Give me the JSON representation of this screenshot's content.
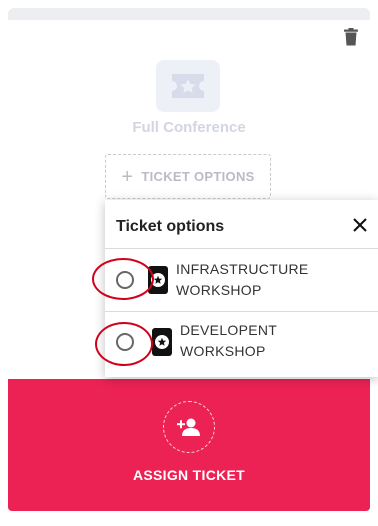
{
  "ticket": {
    "name": "Full Conference",
    "options_button_label": "TICKET OPTIONS",
    "options_button_icon": "plus-icon",
    "delete_icon": "trash-icon",
    "ticket_icon": "ticket-star-icon"
  },
  "popover": {
    "title": "Ticket options",
    "close_icon": "close-icon",
    "options": [
      {
        "line1": "INFRASTRUCTURE",
        "line2": "WORKSHOP",
        "selected": false,
        "icon": "ticket-star-icon"
      },
      {
        "line1": "DEVELOPENT",
        "line2": "WORKSHOP",
        "selected": false,
        "icon": "ticket-star-icon"
      }
    ]
  },
  "assign": {
    "label": "ASSIGN TICKET",
    "icon": "add-person-icon"
  },
  "colors": {
    "accent": "#ec2255",
    "highlight": "#d0021b",
    "muted_text": "#d2d6e2",
    "ticket_icon_bg": "#eef0f7"
  }
}
